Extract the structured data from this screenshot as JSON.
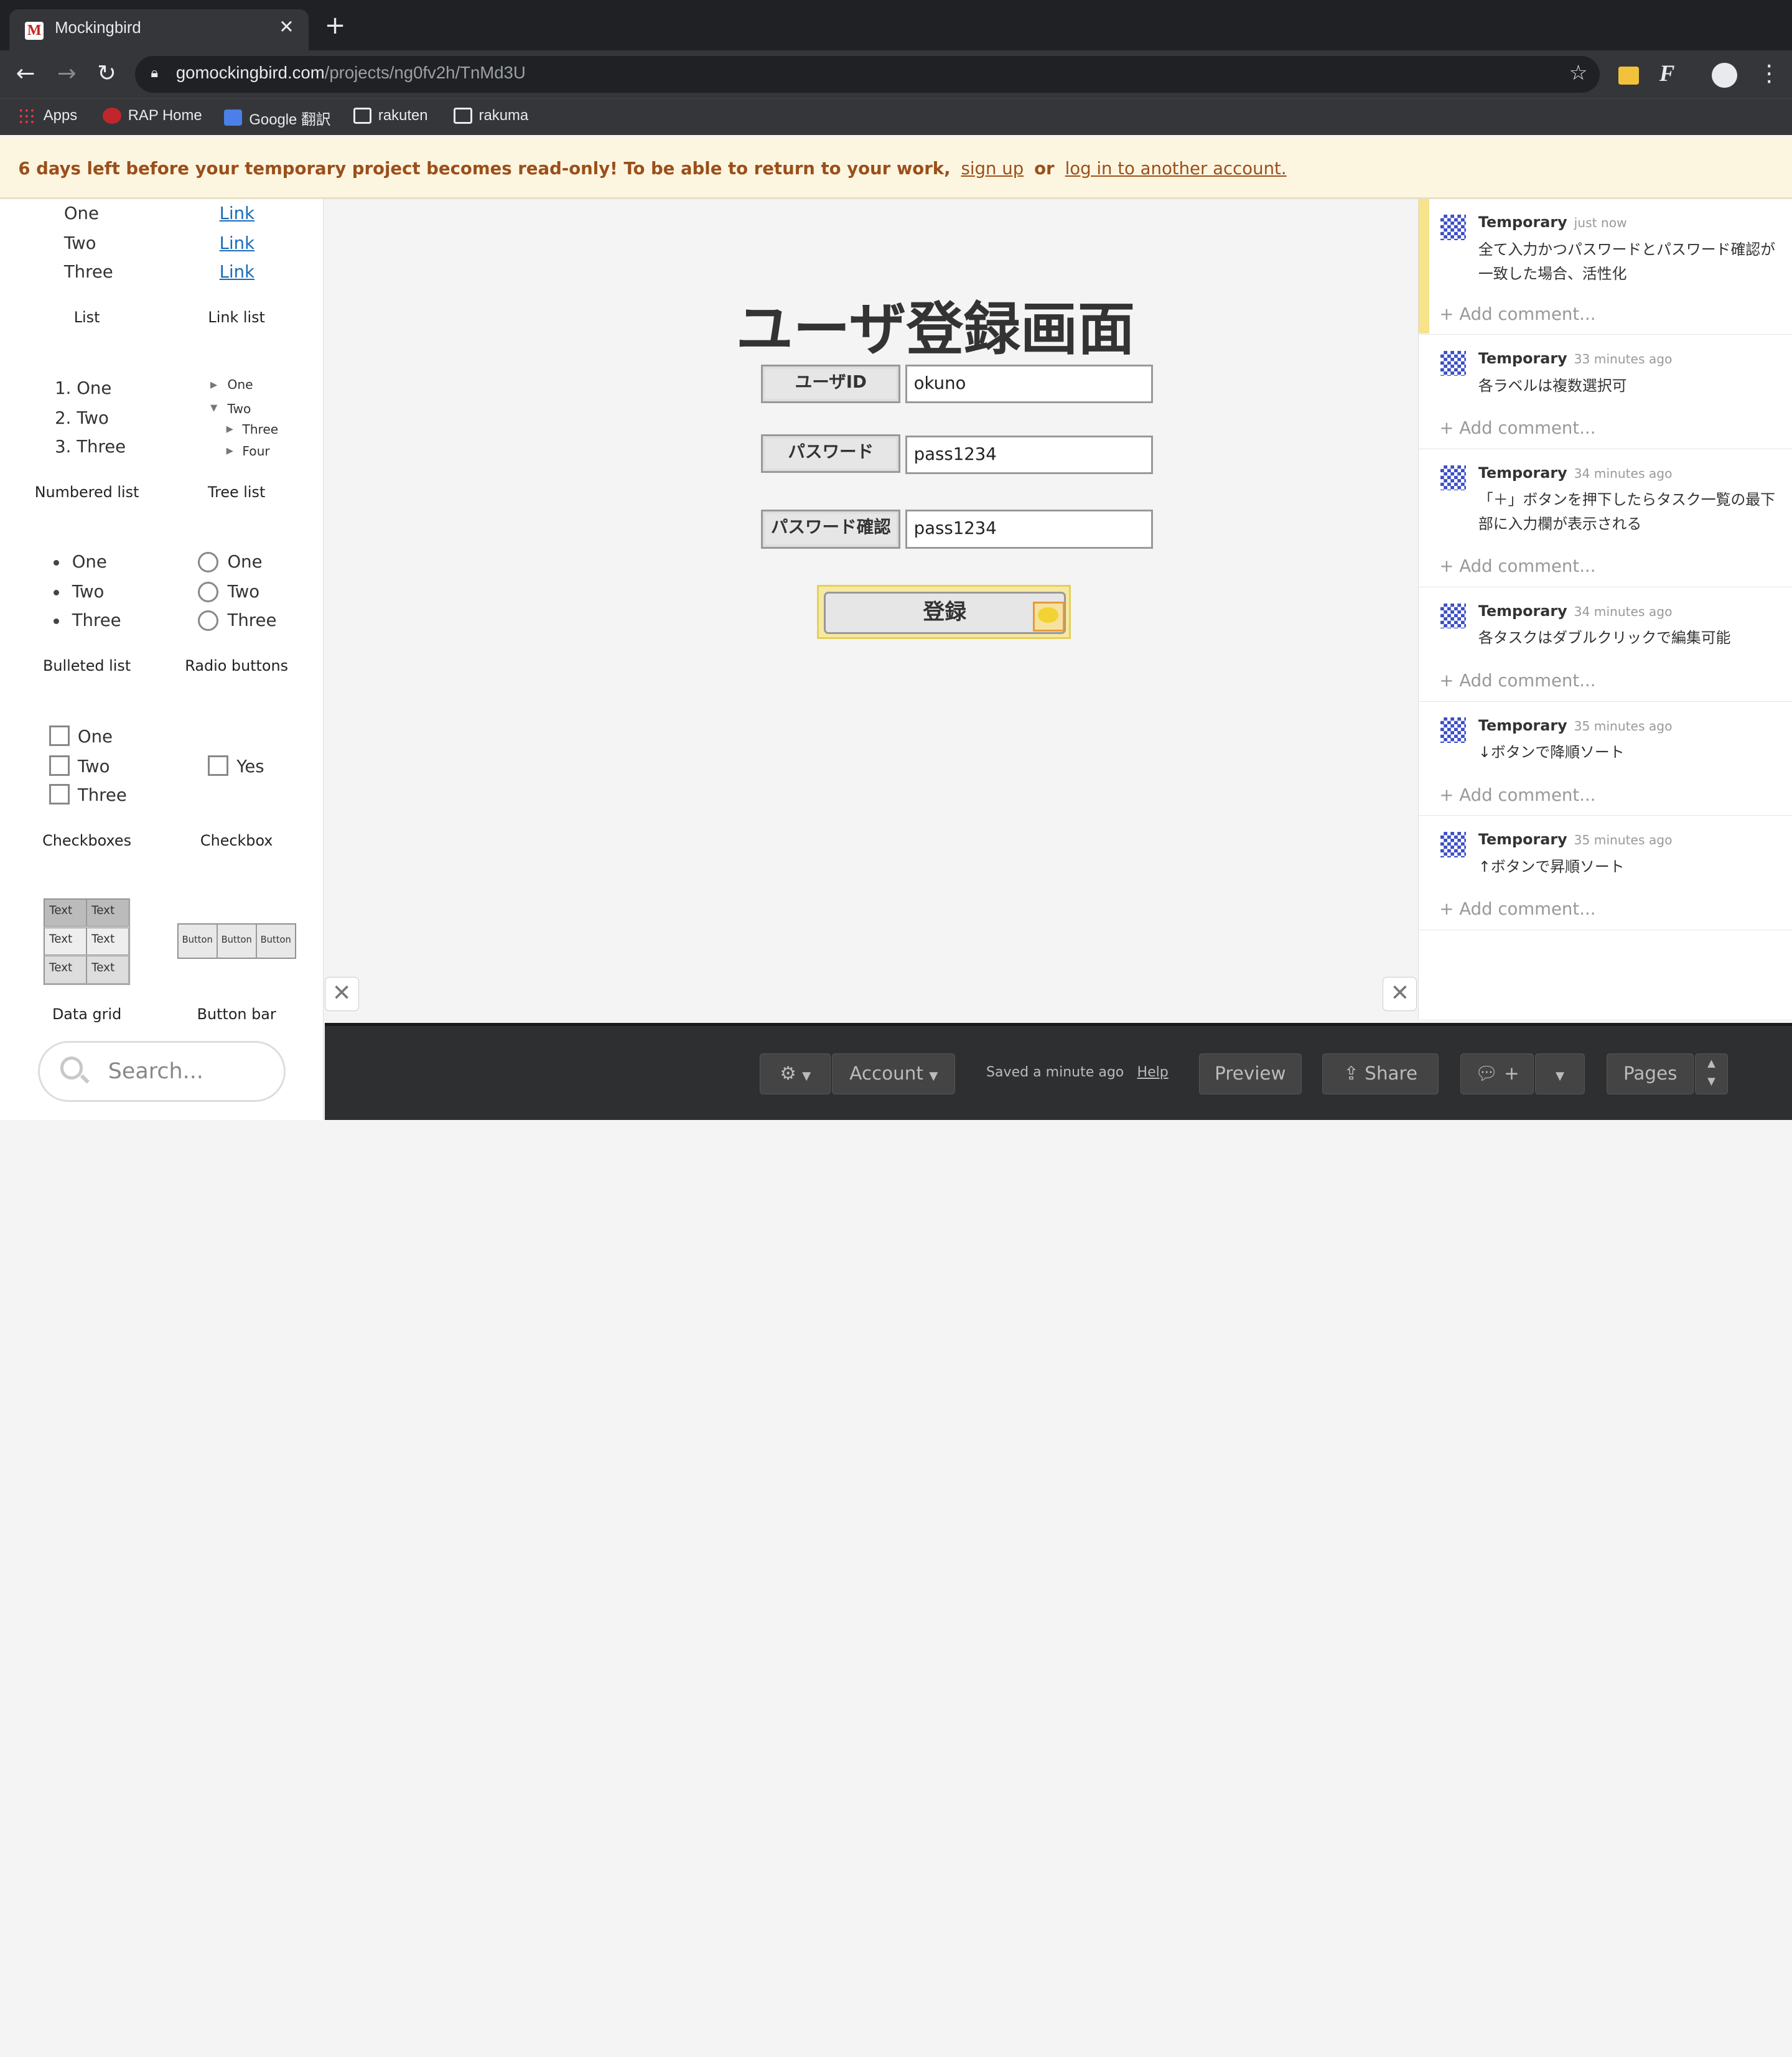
{
  "browser": {
    "tab_title": "Mockingbird",
    "tab_favicon": "M",
    "url_host": "gomockingbird.com",
    "url_path": "/projects/ng0fv2h/TnMd3U",
    "bookmarks": [
      "Apps",
      "RAP Home",
      "Google 翻訳",
      "rakuten",
      "rakuma"
    ]
  },
  "banner": {
    "message": "6 days left before your temporary project becomes read-only! To be able to return to your work,",
    "signup": "sign up",
    "or": "or",
    "login": "log in to another account."
  },
  "palette": {
    "list_items": [
      "One",
      "Two",
      "Three"
    ],
    "link_label": "Link",
    "list_caption": "List",
    "link_list_caption": "Link list",
    "numbered": [
      "1. One",
      "2. Two",
      "3. Three"
    ],
    "tree": [
      "One",
      "Two",
      "Three",
      "Four"
    ],
    "numbered_caption": "Numbered list",
    "tree_caption": "Tree list",
    "bulleted": [
      "One",
      "Two",
      "Three"
    ],
    "radios": [
      "One",
      "Two",
      "Three"
    ],
    "bulleted_caption": "Bulleted list",
    "radio_caption": "Radio buttons",
    "checkboxes": [
      "One",
      "Two",
      "Three"
    ],
    "checkbox_single": "Yes",
    "checkboxes_caption": "Checkboxes",
    "checkbox_caption": "Checkbox",
    "grid_cell": "Text",
    "button_label": "Button",
    "grid_caption": "Data grid",
    "buttonbar_caption": "Button bar",
    "search_placeholder": "Search..."
  },
  "form": {
    "title": "ユーザ登録画面",
    "userid_label": "ユーザID",
    "userid_value": "okuno",
    "password_label": "パスワード",
    "password_value": "pass1234",
    "confirm_label": "パスワード確認",
    "confirm_value": "pass1234",
    "submit_label": "登録"
  },
  "comments": [
    {
      "author": "Temporary",
      "time": "just now",
      "text": "全て入力かつパスワードとパスワード確認が一致した場合、活性化"
    },
    {
      "author": "Temporary",
      "time": "33 minutes ago",
      "text": "各ラベルは複数選択可"
    },
    {
      "author": "Temporary",
      "time": "34 minutes ago",
      "text": "「＋」ボタンを押下したらタスク一覧の最下部に入力欄が表示される"
    },
    {
      "author": "Temporary",
      "time": "34 minutes ago",
      "text": "各タスクはダブルクリックで編集可能"
    },
    {
      "author": "Temporary",
      "time": "35 minutes ago",
      "text": "↓ボタンで降順ソート"
    },
    {
      "author": "Temporary",
      "time": "35 minutes ago",
      "text": "↑ボタンで昇順ソート"
    }
  ],
  "add_comment": "Add comment...",
  "bottom": {
    "account": "Account",
    "saved": "Saved a minute ago",
    "help": "Help",
    "preview": "Preview",
    "share": "Share",
    "comment_plus": "+",
    "pages": "Pages"
  }
}
